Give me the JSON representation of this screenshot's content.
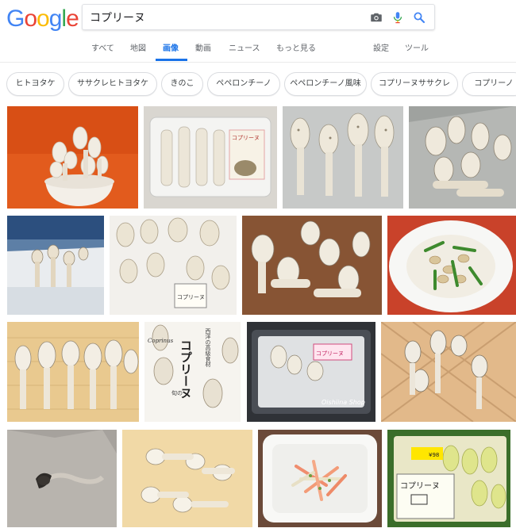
{
  "logo": {
    "text": "Google",
    "letters": [
      "G",
      "o",
      "o",
      "g",
      "l",
      "e"
    ],
    "colors": [
      "#4285f4",
      "#ea4335",
      "#fbbc05",
      "#4285f4",
      "#34a853",
      "#ea4335"
    ]
  },
  "search": {
    "query": "コプリーヌ",
    "placeholder": ""
  },
  "search_icons": [
    "camera-icon",
    "microphone-icon",
    "search-icon"
  ],
  "tabs": [
    {
      "label": "すべて"
    },
    {
      "label": "地図"
    },
    {
      "label": "画像",
      "active": true
    },
    {
      "label": "動画"
    },
    {
      "label": "ニュース"
    },
    {
      "label": "もっと見る"
    }
  ],
  "tools": {
    "settings": "設定",
    "tools": "ツール"
  },
  "chips": [
    "ヒトヨタケ",
    "ササクレヒトヨタケ",
    "きのこ",
    "ペペロンチーノ",
    "ペペロンチーノ風味",
    "コプリーヌササクレ",
    "コプリーノ"
  ],
  "image_text": {
    "pack_label_1": "コプリーヌ",
    "label_2": "コプリーヌ",
    "ad_vertical": "コプリーヌ",
    "ad_side": "西洋の高級食材",
    "ad_brand": "Coprinus",
    "ad_note": "旬の",
    "pack_label_3": "コプリーヌ",
    "watermark": "Oishiina Shop",
    "pack_label_4": "コプリーヌ",
    "price_tag": "¥98"
  },
  "colors": {
    "accent": "#1a73e8",
    "tab_text": "#5f6368",
    "chip_border": "#dadce0"
  }
}
